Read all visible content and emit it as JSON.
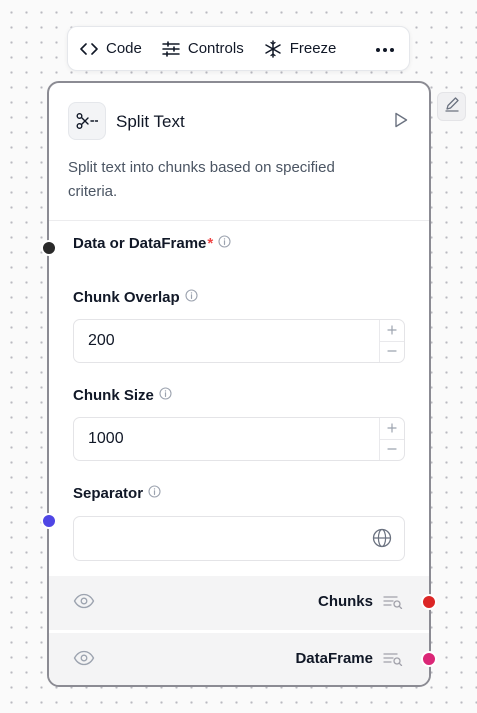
{
  "toolbar": {
    "code_label": "Code",
    "controls_label": "Controls",
    "freeze_label": "Freeze"
  },
  "node": {
    "title": "Split Text",
    "description": "Split text into chunks based on specified criteria.",
    "inputs": {
      "data": {
        "label": "Data or DataFrame",
        "required_mark": "*"
      },
      "chunk_overlap": {
        "label": "Chunk Overlap",
        "value": "200"
      },
      "chunk_size": {
        "label": "Chunk Size",
        "value": "1000"
      },
      "separator": {
        "label": "Separator",
        "value": ""
      }
    },
    "outputs": [
      {
        "name": "Chunks",
        "handle_color": "#dc2626"
      },
      {
        "name": "DataFrame",
        "handle_color": "#db2777"
      }
    ]
  },
  "colors": {
    "data_handle": "#2a2a2a",
    "separator_handle": "#4f46e5"
  }
}
